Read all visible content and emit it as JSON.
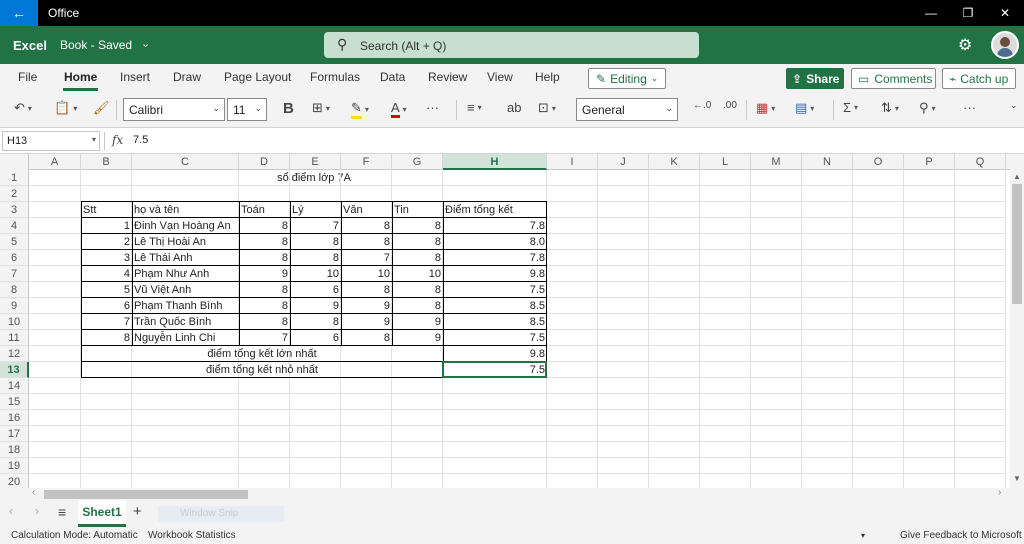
{
  "titlebar": {
    "title": "Office",
    "back_icon": "←",
    "minimize": "—",
    "restore": "❐",
    "close": "✕"
  },
  "appbar": {
    "app_name": "Excel",
    "doc_name": "Book - Saved",
    "search_placeholder": "Search (Alt + Q)"
  },
  "ribbon_tabs": [
    "File",
    "Home",
    "Insert",
    "Draw",
    "Page Layout",
    "Formulas",
    "Data",
    "Review",
    "View",
    "Help"
  ],
  "active_tab": "Home",
  "ribbon_buttons": {
    "editing": "Editing",
    "share": "Share",
    "comments": "Comments",
    "catch_up": "Catch up"
  },
  "toolbar": {
    "font_name": "Calibri",
    "font_size": "11",
    "bold": "B",
    "number_format": "General",
    "more": "···"
  },
  "formula_bar": {
    "name_box": "H13",
    "fx": "fx",
    "value": "7.5"
  },
  "columns": [
    "A",
    "B",
    "C",
    "D",
    "E",
    "F",
    "G",
    "H",
    "I",
    "J",
    "K",
    "L",
    "M",
    "N",
    "O",
    "P",
    "Q"
  ],
  "rows": [
    "1",
    "2",
    "3",
    "4",
    "5",
    "6",
    "7",
    "8",
    "9",
    "10",
    "11",
    "12",
    "13",
    "14",
    "15",
    "16",
    "17",
    "18",
    "19",
    "20",
    "21"
  ],
  "selected_cell": {
    "column": "H",
    "row": "13"
  },
  "sheet": {
    "title": "sổ điểm lớp 7A",
    "headers": [
      "Stt",
      "họ và tên",
      "Toán",
      "Lý",
      "Văn",
      "Tin",
      "Điểm tổng kết"
    ],
    "rows": [
      {
        "stt": "1",
        "name": "Đinh Vạn Hoàng An",
        "toan": "8",
        "ly": "7",
        "van": "8",
        "tin": "8",
        "tong": "7.8"
      },
      {
        "stt": "2",
        "name": "Lê Thị Hoài An",
        "toan": "8",
        "ly": "8",
        "van": "8",
        "tin": "8",
        "tong": "8.0"
      },
      {
        "stt": "3",
        "name": "Lê Thái Anh",
        "toan": "8",
        "ly": "8",
        "van": "7",
        "tin": "8",
        "tong": "7.8"
      },
      {
        "stt": "4",
        "name": "Phạm Như Anh",
        "toan": "9",
        "ly": "10",
        "van": "10",
        "tin": "10",
        "tong": "9.8"
      },
      {
        "stt": "5",
        "name": "Vũ Việt Anh",
        "toan": "8",
        "ly": "6",
        "van": "8",
        "tin": "8",
        "tong": "7.5"
      },
      {
        "stt": "6",
        "name": "Phạm Thanh Bình",
        "toan": "8",
        "ly": "9",
        "van": "9",
        "tin": "8",
        "tong": "8.5"
      },
      {
        "stt": "7",
        "name": "Trần Quốc Bình",
        "toan": "8",
        "ly": "8",
        "van": "9",
        "tin": "9",
        "tong": "8.5"
      },
      {
        "stt": "8",
        "name": "Nguyễn Linh Chi",
        "toan": "7",
        "ly": "6",
        "van": "8",
        "tin": "9",
        "tong": "7.5"
      }
    ],
    "max_label": "điểm tổng kết lớn nhất",
    "max_value": "9.8",
    "min_label": "điểm tổng kết nhỏ nhất",
    "min_value": "7.5"
  },
  "sheet_tabs": [
    "Sheet1"
  ],
  "window_snip": "Window Snip",
  "status": {
    "calc_mode": "Calculation Mode: Automatic",
    "workbook_stats": "Workbook Statistics",
    "feedback": "Give Feedback to Microsoft"
  },
  "colors": {
    "excel_green": "#217346",
    "title_black": "#000000",
    "back_blue": "#0078d7"
  }
}
